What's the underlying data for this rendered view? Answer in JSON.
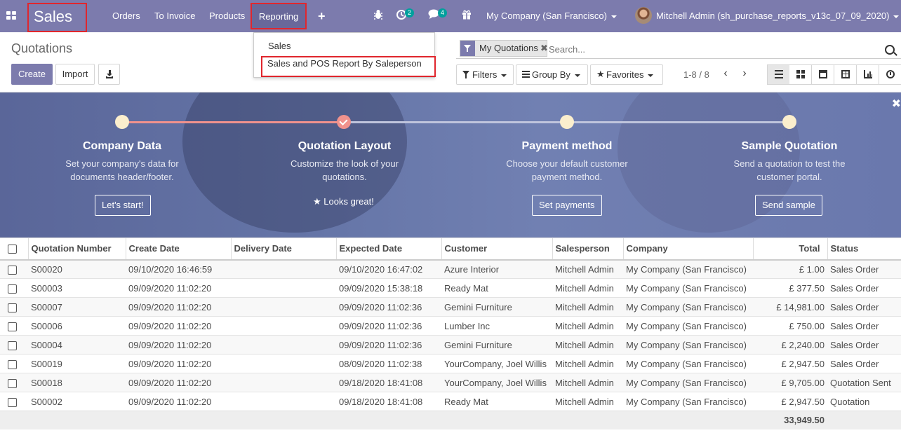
{
  "topbar": {
    "app_name": "Sales",
    "menu": [
      "Orders",
      "To Invoice",
      "Products",
      "Reporting"
    ],
    "activity_count": "2",
    "messages_count": "4",
    "company": "My Company (San Francisco)",
    "user": "Mitchell Admin (sh_purchase_reports_v13c_07_09_2020)"
  },
  "reporting_menu": {
    "items": [
      "Sales",
      "Sales and POS Report By Saleperson"
    ]
  },
  "control": {
    "title": "Quotations",
    "create_label": "Create",
    "import_label": "Import",
    "facet_label": "My Quotations",
    "search_placeholder": "Search...",
    "filters_label": "Filters",
    "groupby_label": "Group By",
    "favorites_label": "Favorites",
    "pager": "1-8 / 8"
  },
  "onboarding": {
    "steps": [
      {
        "title": "Company Data",
        "desc_1": "Set your company's data for",
        "desc_2": "documents header/footer.",
        "button": "Let's start!"
      },
      {
        "title": "Quotation Layout",
        "desc_1": "Customize the look of your",
        "desc_2": "quotations.",
        "done": "Looks great!"
      },
      {
        "title": "Payment method",
        "desc_1": "Choose your default customer",
        "desc_2": "payment method.",
        "button": "Set payments"
      },
      {
        "title": "Sample Quotation",
        "desc_1": "Send a quotation to test the",
        "desc_2": "customer portal.",
        "button": "Send sample"
      }
    ]
  },
  "table": {
    "columns": [
      "Quotation Number",
      "Create Date",
      "Delivery Date",
      "Expected Date",
      "Customer",
      "Salesperson",
      "Company",
      "Total",
      "Status"
    ],
    "rows": [
      [
        "S00020",
        "09/10/2020 16:46:59",
        "",
        "09/10/2020 16:47:02",
        "Azure Interior",
        "Mitchell Admin",
        "My Company (San Francisco)",
        "£ 1.00",
        "Sales Order"
      ],
      [
        "S00003",
        "09/09/2020 11:02:20",
        "",
        "09/09/2020 15:38:18",
        "Ready Mat",
        "Mitchell Admin",
        "My Company (San Francisco)",
        "£ 377.50",
        "Sales Order"
      ],
      [
        "S00007",
        "09/09/2020 11:02:20",
        "",
        "09/09/2020 11:02:36",
        "Gemini Furniture",
        "Mitchell Admin",
        "My Company (San Francisco)",
        "£ 14,981.00",
        "Sales Order"
      ],
      [
        "S00006",
        "09/09/2020 11:02:20",
        "",
        "09/09/2020 11:02:36",
        "Lumber Inc",
        "Mitchell Admin",
        "My Company (San Francisco)",
        "£ 750.00",
        "Sales Order"
      ],
      [
        "S00004",
        "09/09/2020 11:02:20",
        "",
        "09/09/2020 11:02:36",
        "Gemini Furniture",
        "Mitchell Admin",
        "My Company (San Francisco)",
        "£ 2,240.00",
        "Sales Order"
      ],
      [
        "S00019",
        "09/09/2020 11:02:20",
        "",
        "08/09/2020 11:02:38",
        "YourCompany, Joel Willis",
        "Mitchell Admin",
        "My Company (San Francisco)",
        "£ 2,947.50",
        "Sales Order"
      ],
      [
        "S00018",
        "09/09/2020 11:02:20",
        "",
        "09/18/2020 18:41:08",
        "YourCompany, Joel Willis",
        "Mitchell Admin",
        "My Company (San Francisco)",
        "£ 9,705.00",
        "Quotation Sent"
      ],
      [
        "S00002",
        "09/09/2020 11:02:20",
        "",
        "09/18/2020 18:41:08",
        "Ready Mat",
        "Mitchell Admin",
        "My Company (San Francisco)",
        "£ 2,947.50",
        "Quotation"
      ]
    ],
    "footer_total": "33,949.50"
  }
}
